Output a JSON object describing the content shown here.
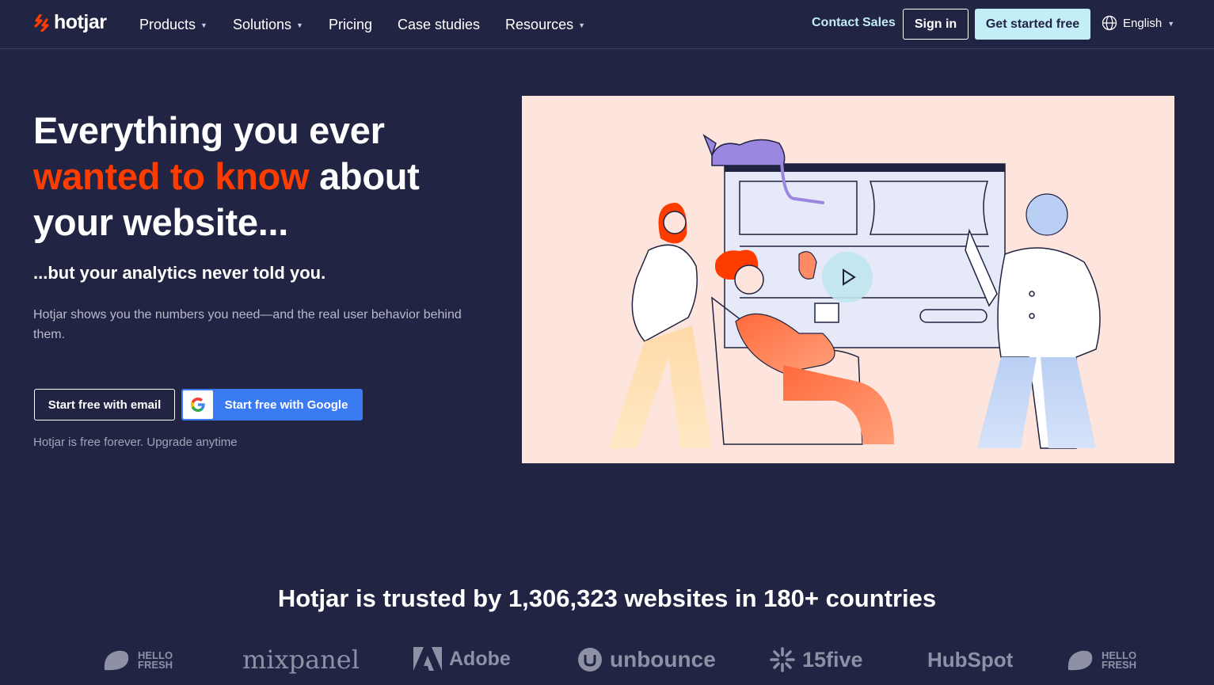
{
  "header": {
    "logo_text": "hotjar",
    "nav": [
      {
        "label": "Products",
        "dropdown": true
      },
      {
        "label": "Solutions",
        "dropdown": true
      },
      {
        "label": "Pricing",
        "dropdown": false
      },
      {
        "label": "Case studies",
        "dropdown": false
      },
      {
        "label": "Resources",
        "dropdown": true
      }
    ],
    "contact_sales": "Contact Sales",
    "sign_in": "Sign in",
    "get_started": "Get started free",
    "language": "English"
  },
  "hero": {
    "title_line1": "Everything you ever",
    "title_accent": "wanted to know",
    "title_rest": " about",
    "title_line3": "your website...",
    "subtitle": "...but your analytics never told you.",
    "description": "Hotjar shows you the numbers you need—and the real user behavior behind them.",
    "btn_email": "Start free with email",
    "btn_google": "Start free with Google",
    "free_note": "Hotjar is free forever. Upgrade anytime"
  },
  "trusted": {
    "text": "Hotjar is trusted by 1,306,323 websites in 180+ countries",
    "logos": [
      "HELLO FRESH",
      "mixpanel",
      "Adobe",
      "unbounce",
      "15five",
      "HubSpot",
      "HELLO FRESH"
    ]
  },
  "colors": {
    "background": "#212442",
    "accent": "#ff3c00",
    "cta": "#c4eef7",
    "google_blue": "#3b7bf2",
    "illustration_bg": "#fde4dc"
  },
  "icons": [
    "hotjar-logo-icon",
    "chevron-down-icon",
    "globe-icon",
    "google-icon",
    "play-icon"
  ]
}
